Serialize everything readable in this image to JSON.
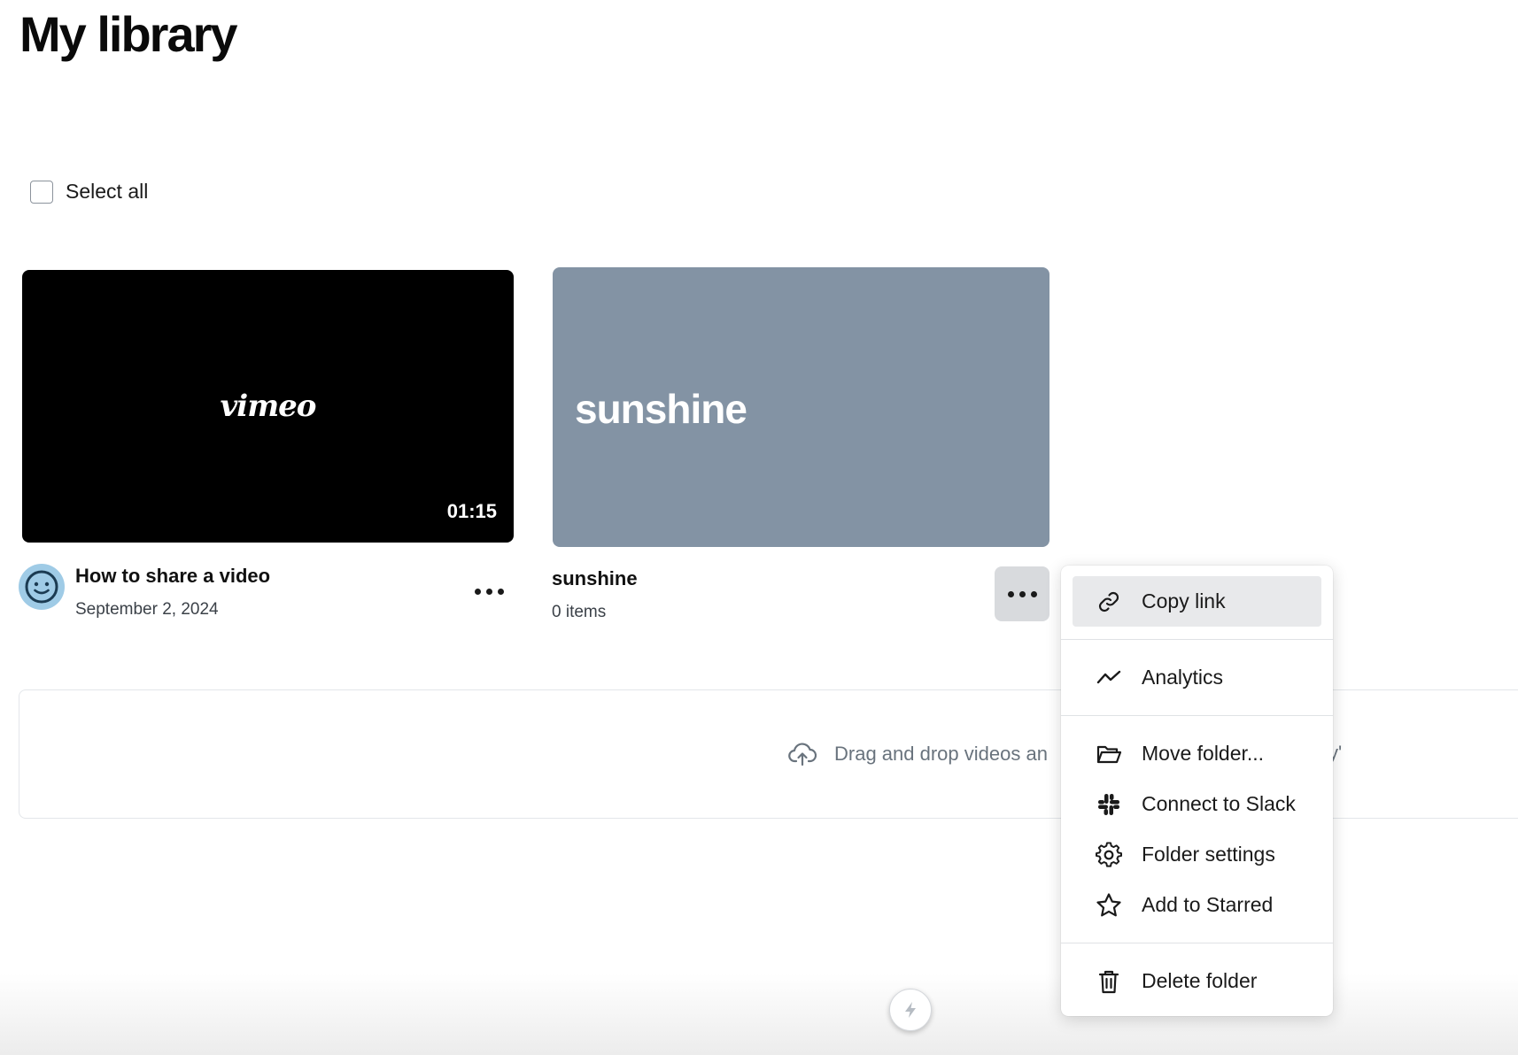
{
  "page": {
    "title": "My library"
  },
  "selection": {
    "select_all_label": "Select all"
  },
  "video": {
    "thumb_logo": "vimeo",
    "duration": "01:15",
    "title": "How to share a video",
    "date": "September 2, 2024"
  },
  "folder": {
    "thumb_title": "sunshine",
    "title": "sunshine",
    "count": "0 items"
  },
  "dropzone": {
    "text": "Drag and drop videos an",
    "trailing": "y'"
  },
  "menu": {
    "items": [
      {
        "label": "Copy link",
        "icon": "link-icon"
      },
      {
        "label": "Analytics",
        "icon": "analytics-icon"
      },
      {
        "label": "Move folder...",
        "icon": "folder-icon"
      },
      {
        "label": "Connect to Slack",
        "icon": "slack-icon"
      },
      {
        "label": "Folder settings",
        "icon": "gear-icon"
      },
      {
        "label": "Add to Starred",
        "icon": "star-icon"
      },
      {
        "label": "Delete folder",
        "icon": "trash-icon"
      }
    ]
  },
  "colors": {
    "folder_thumb": "#8393a4",
    "avatar": "#9fcbe6",
    "menu_active": "#e8e9eb"
  }
}
